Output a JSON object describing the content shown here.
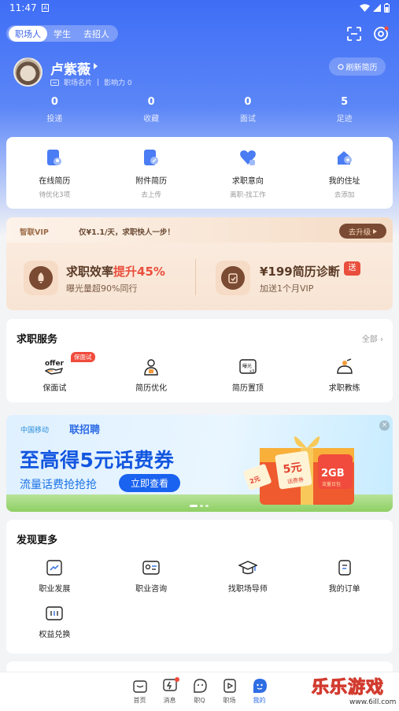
{
  "status": {
    "time": "11:47",
    "a_icon": "A"
  },
  "header": {
    "segments": [
      "职场人",
      "学生",
      "去招人"
    ],
    "active_segment": 0,
    "user": {
      "name": "卢紫薇",
      "card_label": "职场名片",
      "influence": "影响力 0"
    },
    "refresh_label": "刷新简历"
  },
  "stats": [
    {
      "value": "0",
      "label": "投递"
    },
    {
      "value": "0",
      "label": "收藏"
    },
    {
      "value": "0",
      "label": "面试"
    },
    {
      "value": "5",
      "label": "足迹"
    }
  ],
  "quick": [
    {
      "title": "在线简历",
      "sub": "待优化3项",
      "icon": "resume-user-icon"
    },
    {
      "title": "附件简历",
      "sub": "去上传",
      "icon": "attachment-resume-icon"
    },
    {
      "title": "求职意向",
      "sub": "离职-找工作",
      "icon": "heart-edit-icon"
    },
    {
      "title": "我的住址",
      "sub": "去添加",
      "icon": "home-location-icon"
    }
  ],
  "vip": {
    "logo": "智联VIP",
    "slogan": "仅¥1.1/天，求职快人一步！",
    "upgrade": "去升级",
    "left": {
      "title_prefix": "求职效率",
      "title_highlight": "提升45%",
      "desc": "曝光量超90%同行"
    },
    "right": {
      "title": "¥199简历诊断",
      "tag": "送",
      "desc": "加送1个月VIP"
    }
  },
  "services": {
    "title": "求职服务",
    "all": "全部",
    "tag": "保面试",
    "items": [
      {
        "label": "保面试",
        "icon": "offer-hand-icon",
        "icon_text": "offer"
      },
      {
        "label": "简历优化",
        "icon": "resume-person-icon"
      },
      {
        "label": "简历置顶",
        "icon": "exposure-x3-icon",
        "icon_text": "曝光"
      },
      {
        "label": "求职教练",
        "icon": "coach-icon"
      }
    ]
  },
  "banner": {
    "carrier": "中国移动",
    "brand": "联招聘",
    "headline": "至高得5元话费券",
    "sub": "流量话费抢抢抢",
    "cta": "立即查看",
    "close": "×",
    "coupon_amount": "5元",
    "coupon_label": "话费券",
    "coupon_small": "2元",
    "data_amount": "2GB",
    "data_label": "流量日包"
  },
  "discover": {
    "title": "发现更多",
    "items": [
      {
        "label": "职业发展",
        "icon": "trend-icon"
      },
      {
        "label": "职业咨询",
        "icon": "consult-card-icon"
      },
      {
        "label": "找职场导师",
        "icon": "graduation-cap-icon"
      },
      {
        "label": "我的订单",
        "icon": "order-icon"
      },
      {
        "label": "权益兑换",
        "icon": "ticket-icon"
      }
    ]
  },
  "tabs": [
    {
      "label": "首页",
      "icon": "home-bag-icon"
    },
    {
      "label": "消息",
      "icon": "message-bolt-icon"
    },
    {
      "label": "职Q",
      "icon": "chat-face-icon"
    },
    {
      "label": "职场",
      "icon": "play-page-icon"
    },
    {
      "label": "我的",
      "icon": "me-face-icon"
    }
  ],
  "watermark": {
    "text": "乐乐游戏",
    "url": "www.6ill.com"
  }
}
